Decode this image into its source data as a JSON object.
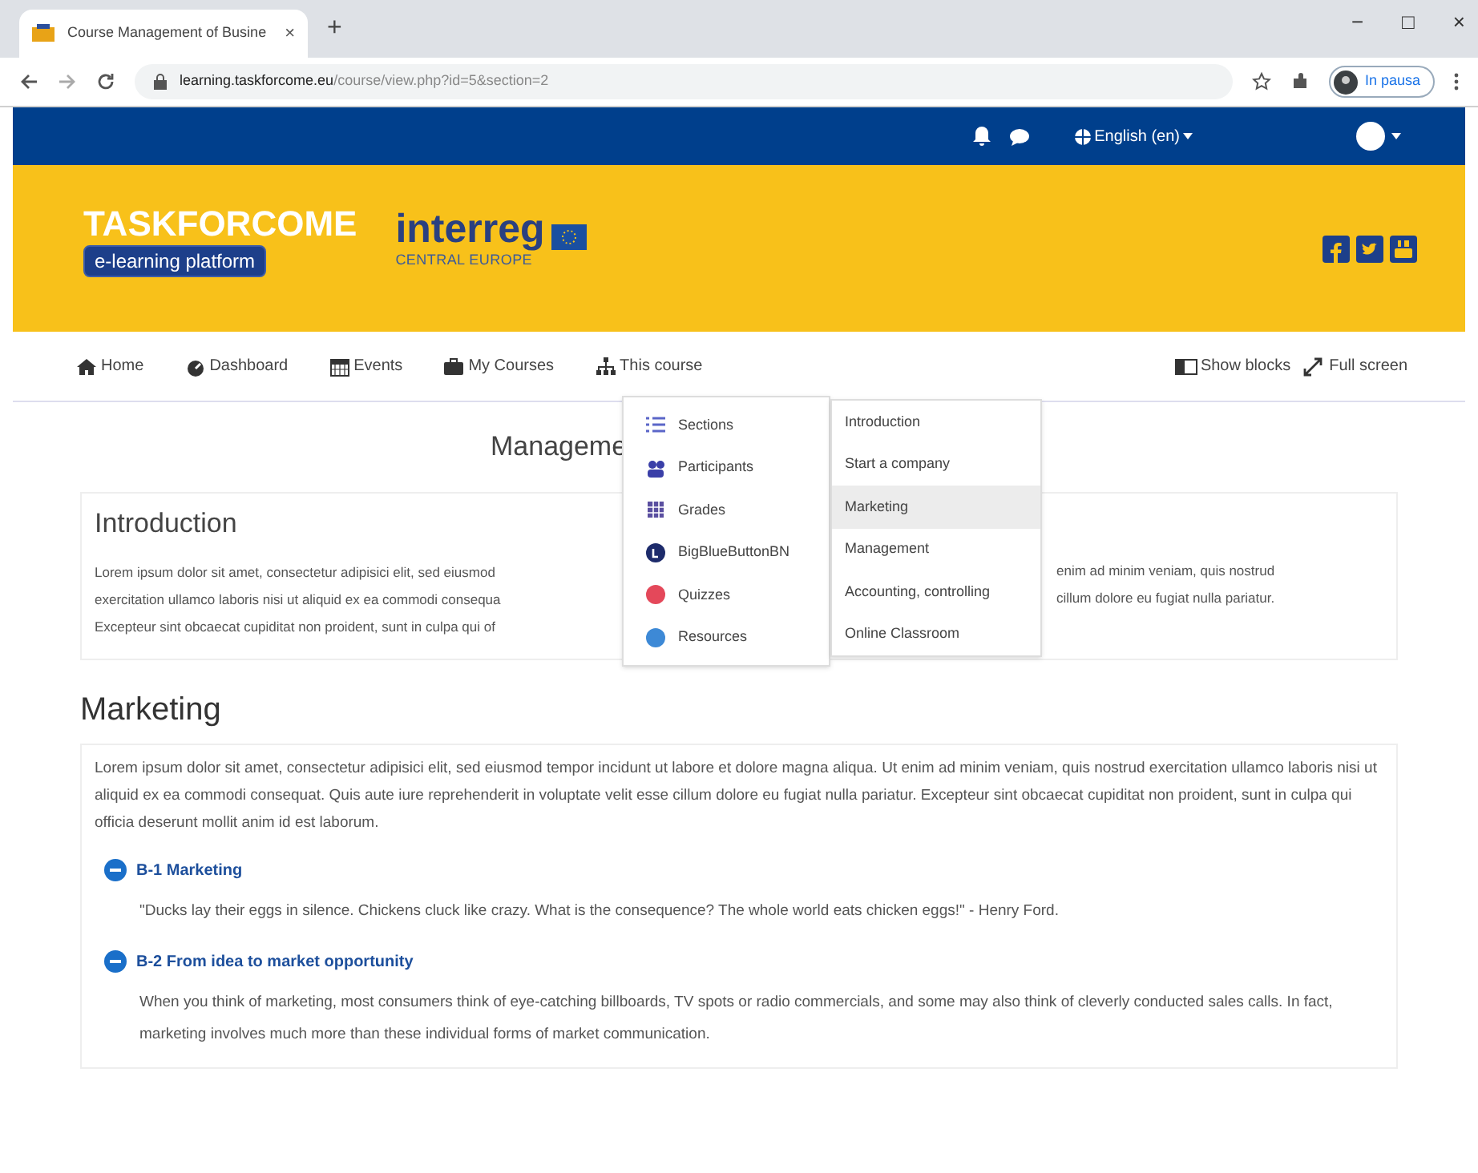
{
  "browser": {
    "tab_title": "Course Management of Busine",
    "tab_close": "×",
    "new_tab": "+",
    "window_controls": [
      "−",
      "□",
      "×"
    ],
    "url_host": "learning.taskforcome.eu",
    "url_path": "/course/view.php?id=5&section=2",
    "profile": "In pausa"
  },
  "topbar": {
    "language": "English (en)"
  },
  "header": {
    "brand": "TASKFORCOME",
    "tagline": "e-learning platform",
    "partner": "interreg",
    "partner_sub": "CENTRAL EUROPE"
  },
  "nav": {
    "items": [
      "Home",
      "Dashboard",
      "Events",
      "My Courses",
      "This course"
    ],
    "right": [
      "Show blocks",
      "Full screen"
    ]
  },
  "course_menu": {
    "items": [
      "Sections",
      "Participants",
      "Grades",
      "BigBlueButtonBN",
      "Quizzes",
      "Resources"
    ]
  },
  "sections_menu": {
    "items": [
      {
        "label": "Introduction",
        "selected": false
      },
      {
        "label": "Start a company",
        "selected": false
      },
      {
        "label": "Marketing",
        "selected": true
      },
      {
        "label": "Management",
        "selected": false
      },
      {
        "label": "Accounting, controlling",
        "selected": false
      },
      {
        "label": "Online Classroom",
        "selected": false
      }
    ]
  },
  "page_title": "Manageme",
  "intro": {
    "heading": "Introduction",
    "lines": [
      {
        "left": "Lorem ipsum dolor sit amet, consectetur adipisici elit, sed eiusmod",
        "right": "enim ad minim veniam, quis nostrud"
      },
      {
        "left": "exercitation ullamco laboris nisi ut aliquid ex ea commodi consequa",
        "right": "cillum dolore eu fugiat nulla pariatur."
      },
      {
        "left": "Excepteur sint obcaecat cupiditat non proident, sunt in culpa qui of"
      }
    ]
  },
  "marketing": {
    "heading": "Marketing",
    "text": "Lorem ipsum dolor sit amet, consectetur adipisici elit, sed eiusmod tempor incidunt ut labore et dolore magna aliqua. Ut enim ad minim veniam, quis nostrud exercitation ullamco laboris nisi ut aliquid ex ea commodi consequat. Quis aute iure reprehenderit in voluptate velit esse cillum dolore eu fugiat nulla pariatur. Excepteur sint obcaecat cupiditat non proident, sunt in culpa qui officia deserunt mollit anim id est laborum.",
    "subsections": [
      {
        "title": "B-1 Marketing",
        "text": "\"Ducks lay their eggs in silence. Chickens cluck like crazy. What is the consequence? The whole world eats chicken eggs!\" - Henry Ford."
      },
      {
        "title": "B-2 From idea to market opportunity",
        "text": "When you think of marketing, most consumers think of eye-catching billboards, TV spots or radio commercials, and some may also think of cleverly conducted sales calls. In fact, marketing involves much more than these individual forms of market communication."
      }
    ]
  }
}
